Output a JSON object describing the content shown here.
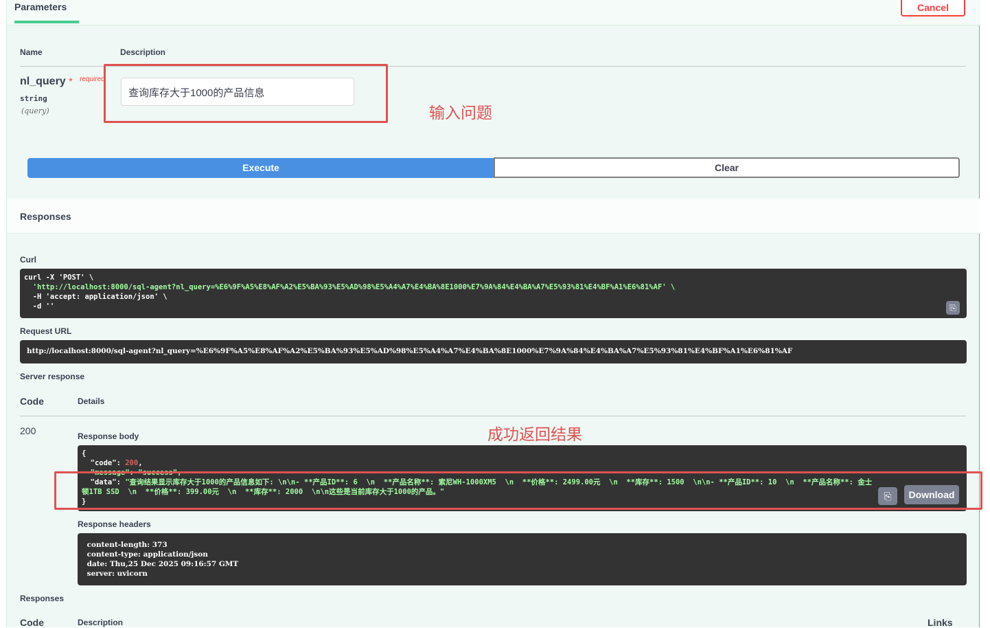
{
  "parameters": {
    "tab_label": "Parameters",
    "cancel_label": "Cancel",
    "col_name": "Name",
    "col_description": "Description",
    "param": {
      "name": "nl_query",
      "star": "*",
      "required_label": "required",
      "type": "string",
      "in": "(query)",
      "value": "查询库存大于1000的产品信息"
    },
    "annotation": "输入问题",
    "execute_label": "Execute",
    "clear_label": "Clear"
  },
  "responses": {
    "title": "Responses",
    "curl_label": "Curl",
    "curl_lines": [
      "curl -X 'POST' \\",
      "  'http://localhost:8000/sql-agent?nl_query=%E6%9F%A5%E8%AF%A2%E5%BA%93%E5%AD%98%E5%A4%A7%E4%BA%8E1000%E7%9A%84%E4%BA%A7%E5%93%81%E4%BF%A1%E6%81%AF' \\",
      "  -H 'accept: application/json' \\",
      "  -d ''"
    ],
    "request_url_label": "Request URL",
    "request_url": "http://localhost:8000/sql-agent?nl_query=%E6%9F%A5%E8%AF%A2%E5%BA%93%E5%AD%98%E5%A4%A7%E4%BA%8E1000%E7%9A%84%E4%BA%A7%E5%93%81%E4%BF%A1%E6%81%AF",
    "server_response_label": "Server response",
    "code_header": "Code",
    "details_header": "Details",
    "status_code": "200",
    "response_body_label": "Response body",
    "annotation": "成功返回结果",
    "body": {
      "open": "{",
      "code_key": "  \"code\": ",
      "code_val": "200",
      "code_comma": ",",
      "message_line": "  \"message\": \"success\",",
      "data_key": "  \"data\": ",
      "data_val_1": "\"查询结果显示库存大于1000的产品信息如下: \\n\\n- **产品ID**: 6  \\n  **产品名称**: 索尼WH-1000XM5  \\n  **价格**: 2499.00元  \\n  **库存**: 1500  \\n\\n- **产品ID**: 10  \\n  **产品名称**: 金士",
      "data_val_2": "顿1TB SSD  \\n  **价格**: 399.00元  \\n  **库存**: 2000  \\n\\n这些是当前库存大于1000的产品。\"",
      "close": "}"
    },
    "download_label": "Download",
    "response_headers_label": "Response headers",
    "headers_lines": [
      " content-length: 373",
      " content-type: application/json",
      " date: Thu,25 Dec 2025 09:16:57 GMT",
      " server: uvicorn"
    ],
    "footer_title": "Responses",
    "footer_code": "Code",
    "footer_description": "Description",
    "footer_links": "Links"
  }
}
